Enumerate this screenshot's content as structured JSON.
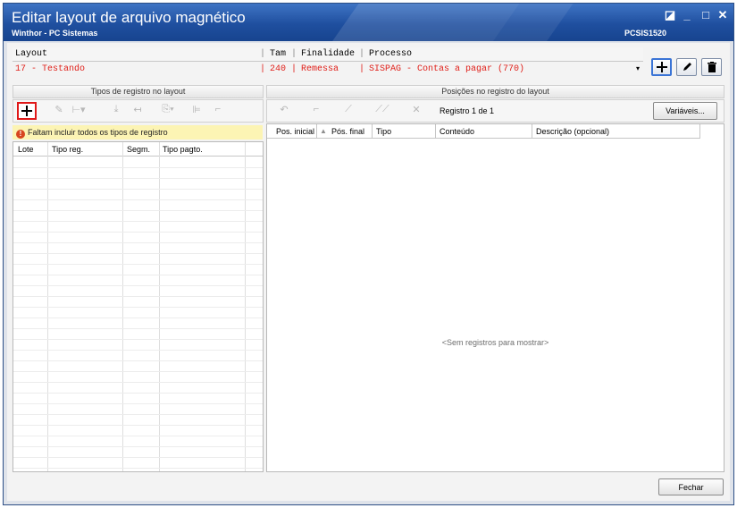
{
  "window": {
    "title": "Editar layout de arquivo magnético",
    "subtitle": "Winthor - PC Sistemas",
    "code": "PCSIS1520",
    "minimize": "_",
    "restore": "◪",
    "close": "✕"
  },
  "layout_table": {
    "headers": {
      "layout": "Layout",
      "tam": "Tam",
      "finalidade": "Finalidade",
      "processo": "Processo"
    },
    "row": {
      "layout": "17 - Testando",
      "tam": "240",
      "finalidade": "Remessa",
      "processo": "SISPAG - Contas a pagar (770)"
    },
    "dropdown_arrow": "▾"
  },
  "layout_buttons": {
    "add": "+",
    "edit": "✎",
    "delete": "🗑"
  },
  "left_panel": {
    "title": "Tipos de registro no layout",
    "warning": "Faltam incluir todos os tipos de registro",
    "warning_icon": "!",
    "columns": [
      "Lote",
      "Tipo reg.",
      "Segm.",
      "Tipo pagto."
    ]
  },
  "right_panel": {
    "title": "Posições no registro do layout",
    "record_counter": "Registro 1 de 1",
    "variables_button": "Variáveis...",
    "columns": [
      "Pos. inicial",
      "Pós. final",
      "Tipo",
      "Conteúdo",
      "Descrição (opcional)"
    ],
    "sort_indicator": "▲",
    "empty_message": "<Sem registros para mostrar>"
  },
  "footer": {
    "close_button": "Fechar"
  },
  "icons": [
    "add-icon",
    "edit-icon",
    "trash-icon",
    "warning-icon",
    "chevron-down-icon"
  ],
  "colors": {
    "title_bar": "#1f4f9f",
    "accent_text": "#e0201a",
    "warning_bg": "#fcf4b4",
    "highlight_border": "#e01818"
  }
}
